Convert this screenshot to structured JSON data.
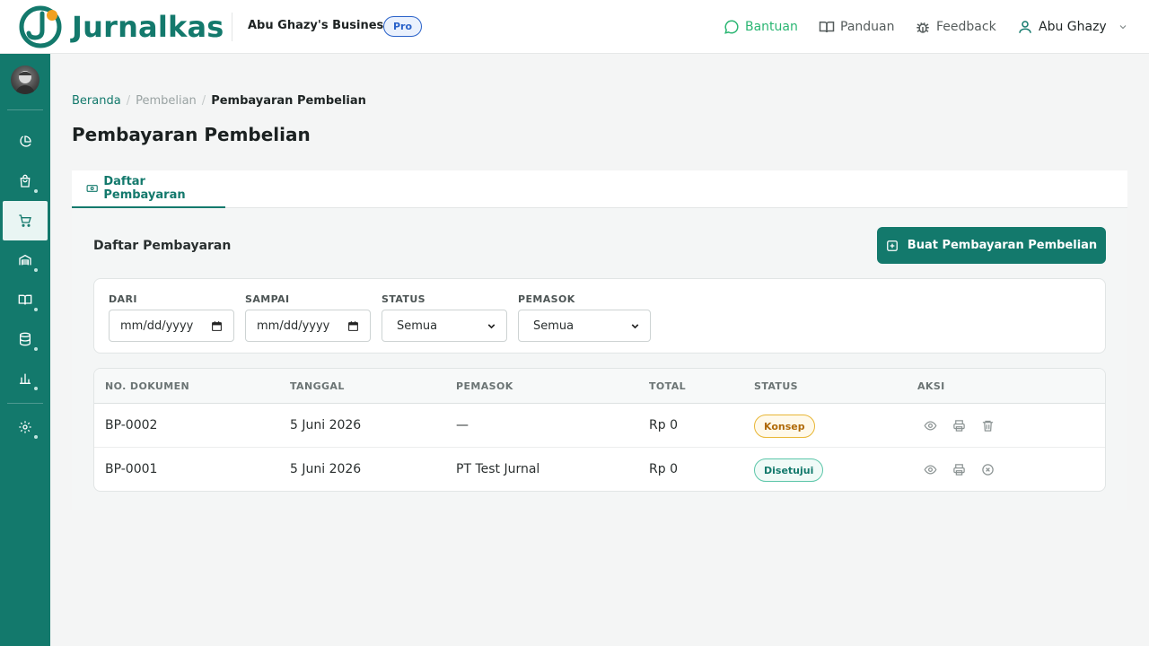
{
  "app": {
    "name": "Jurnalkas",
    "brand_color": "#13796c"
  },
  "header": {
    "business_name": "Abu Ghazy's Business",
    "plan_badge": "Pro",
    "nav": [
      {
        "label": "Bantuan",
        "icon": "chat-bubble-icon"
      },
      {
        "label": "Panduan",
        "icon": "book-open-icon"
      },
      {
        "label": "Feedback",
        "icon": "bug-icon"
      }
    ],
    "user": {
      "name": "Abu Ghazy",
      "icon": "user-icon"
    }
  },
  "sidebar": {
    "items": [
      {
        "icon": "pie-chart-icon",
        "active": false,
        "has_submenu": false
      },
      {
        "icon": "shopping-bag-icon",
        "active": false,
        "has_submenu": true
      },
      {
        "icon": "shopping-cart-icon",
        "active": true,
        "has_submenu": false
      },
      {
        "icon": "inventory-icon",
        "active": false,
        "has_submenu": true
      },
      {
        "icon": "book-icon",
        "active": false,
        "has_submenu": true
      },
      {
        "icon": "database-icon",
        "active": false,
        "has_submenu": true
      },
      {
        "icon": "bar-chart-icon",
        "active": false,
        "has_submenu": true
      },
      {
        "icon": "settings-icon",
        "active": false,
        "has_submenu": true
      }
    ]
  },
  "breadcrumb": {
    "home": "Beranda",
    "parent": "Pembelian",
    "current": "Pembayaran Pembelian"
  },
  "page": {
    "title": "Pembayaran Pembelian"
  },
  "tabs": [
    {
      "label": "Daftar Pembayaran",
      "icon": "cash-icon",
      "active": true
    }
  ],
  "panel": {
    "title": "Daftar Pembayaran",
    "create_button": "Buat Pembayaran Pembelian"
  },
  "filters": {
    "from": {
      "label": "DARI",
      "placeholder": "mm/dd/yyyy"
    },
    "to": {
      "label": "SAMPAI",
      "placeholder": "mm/dd/yyyy"
    },
    "status": {
      "label": "STATUS",
      "value": "Semua"
    },
    "supplier": {
      "label": "PEMASOK",
      "value": "Semua"
    }
  },
  "table": {
    "columns": [
      "NO. DOKUMEN",
      "TANGGAL",
      "PEMASOK",
      "TOTAL",
      "STATUS",
      "AKSI"
    ],
    "rows": [
      {
        "doc_no": "BP-0002",
        "date": "5 Juni 2026",
        "supplier": "—",
        "total": "Rp 0",
        "status": "Konsep",
        "actions": [
          "eye-icon",
          "printer-icon",
          "trash-icon"
        ]
      },
      {
        "doc_no": "BP-0001",
        "date": "5 Juni 2026",
        "supplier": "PT Test Jurnal",
        "total": "Rp 0",
        "status": "Disetujui",
        "actions": [
          "eye-icon",
          "printer-icon",
          "x-circle-icon"
        ]
      }
    ]
  },
  "colors": {
    "primary": "#13796c",
    "help": "#2bb673",
    "pro": "#2a62c9",
    "draft": "#e8b635",
    "approved": "#5cc6a9"
  }
}
